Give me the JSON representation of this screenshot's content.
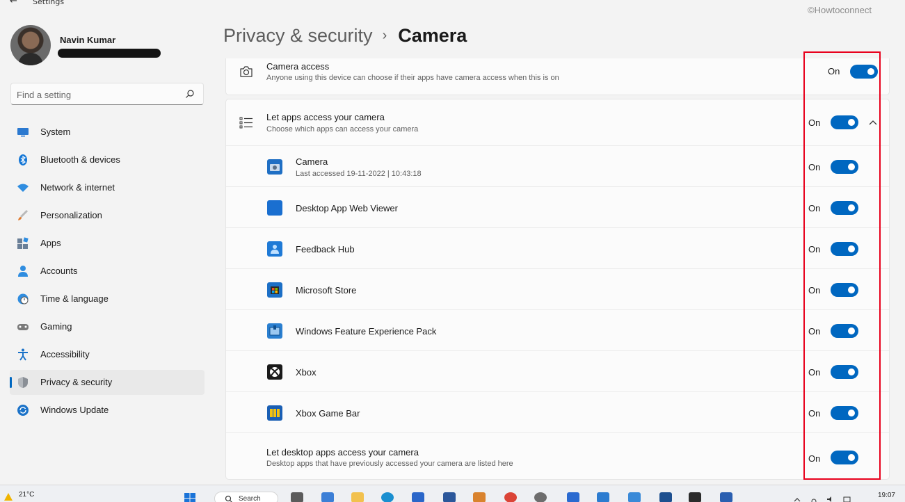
{
  "window": {
    "title": "Settings",
    "watermark": "©Howtoconnect"
  },
  "user": {
    "name": "Navin Kumar"
  },
  "search": {
    "placeholder": "Find a setting"
  },
  "sidebar": {
    "items": [
      {
        "label": "System",
        "icon": "system-icon",
        "color": "#2b79d0"
      },
      {
        "label": "Bluetooth & devices",
        "icon": "bluetooth-icon",
        "color": "#1577d6"
      },
      {
        "label": "Network & internet",
        "icon": "network-icon",
        "color": "#2f8de0"
      },
      {
        "label": "Personalization",
        "icon": "brush-icon",
        "color": "#e07a2e"
      },
      {
        "label": "Apps",
        "icon": "apps-icon",
        "color": "#6a7f97"
      },
      {
        "label": "Accounts",
        "icon": "accounts-icon",
        "color": "#2f8de0"
      },
      {
        "label": "Time & language",
        "icon": "clock-globe-icon",
        "color": "#2f8de0"
      },
      {
        "label": "Gaming",
        "icon": "gamepad-icon",
        "color": "#7a7a7a"
      },
      {
        "label": "Accessibility",
        "icon": "accessibility-icon",
        "color": "#1b72c8"
      },
      {
        "label": "Privacy & security",
        "icon": "shield-icon",
        "color": "#8a8f96"
      },
      {
        "label": "Windows Update",
        "icon": "update-icon",
        "color": "#1b72c8"
      }
    ],
    "selected_index": 9
  },
  "header": {
    "parent": "Privacy & security",
    "separator": "›",
    "current": "Camera"
  },
  "camera_access": {
    "title": "Camera access",
    "subtitle": "Anyone using this device can choose if their apps have camera access when this is on",
    "state": "On",
    "icon": "camera-icon"
  },
  "apps_access": {
    "title": "Let apps access your camera",
    "subtitle": "Choose which apps can access your camera",
    "state": "On",
    "icon": "list-icon",
    "expanded": true
  },
  "apps": [
    {
      "name": "Camera",
      "subtitle": "Last accessed 19-11-2022  |  10:43:18",
      "state": "On",
      "icon": "camera-app-icon",
      "color": "#1f6fc4"
    },
    {
      "name": "Desktop App Web Viewer",
      "subtitle": "",
      "state": "On",
      "icon": "web-viewer-icon",
      "color": "#1a6fd0"
    },
    {
      "name": "Feedback Hub",
      "subtitle": "",
      "state": "On",
      "icon": "feedback-hub-icon",
      "color": "#1f7ad6"
    },
    {
      "name": "Microsoft Store",
      "subtitle": "",
      "state": "On",
      "icon": "store-icon",
      "color": "#1c6fc6"
    },
    {
      "name": "Windows Feature Experience Pack",
      "subtitle": "",
      "state": "On",
      "icon": "feature-pack-icon",
      "color": "#2a7fd0"
    },
    {
      "name": "Xbox",
      "subtitle": "",
      "state": "On",
      "icon": "xbox-icon",
      "color": "#1a1a1a"
    },
    {
      "name": "Xbox Game Bar",
      "subtitle": "",
      "state": "On",
      "icon": "game-bar-icon",
      "color": "#1a5fb4"
    }
  ],
  "desktop_apps": {
    "title": "Let desktop apps access your camera",
    "subtitle": "Desktop apps that have previously accessed your camera are listed here",
    "state": "On"
  },
  "taskbar": {
    "temperature": "21°C",
    "search_label": "Search",
    "time": "19:07"
  },
  "colors": {
    "accent": "#0067c0",
    "highlight": "#e8001c"
  }
}
